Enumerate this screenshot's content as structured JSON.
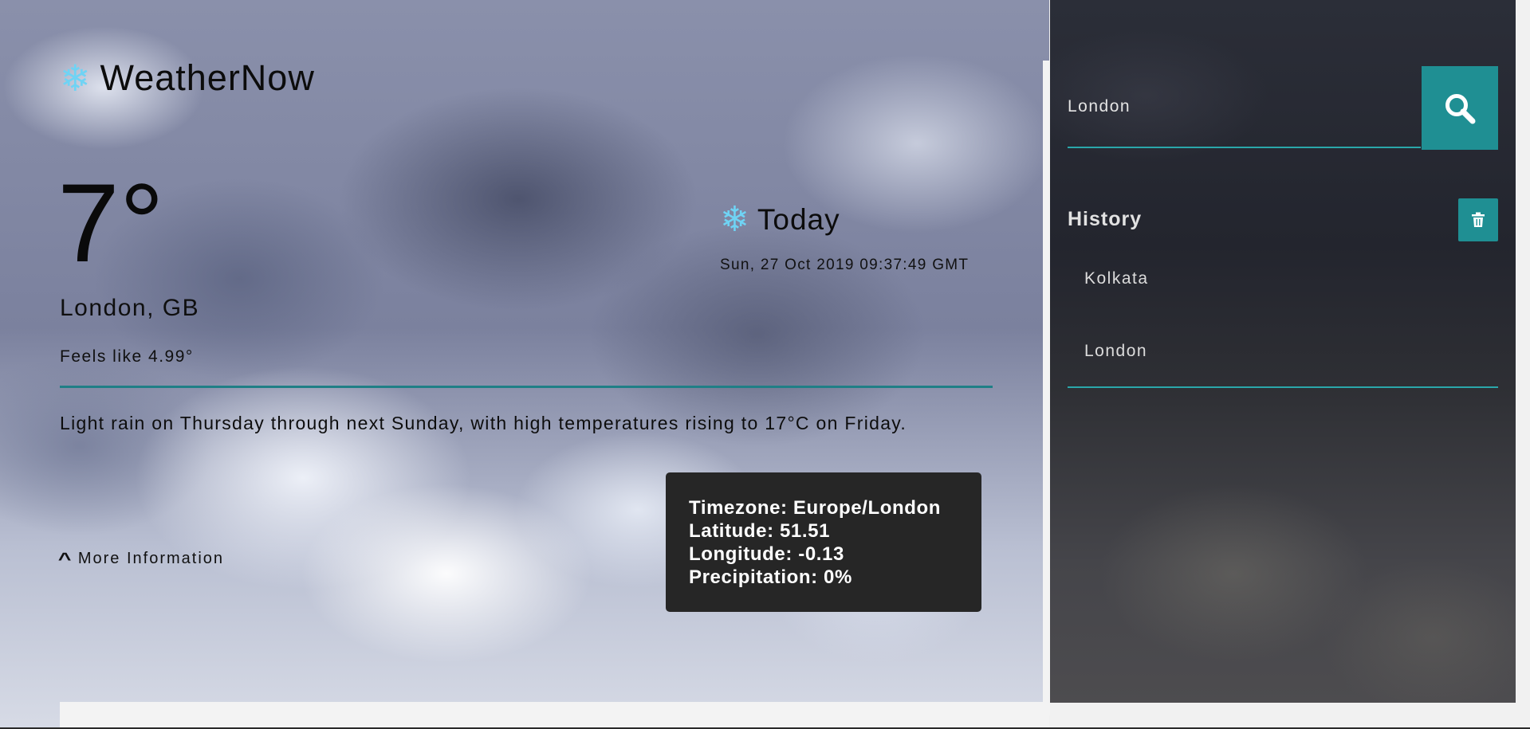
{
  "brand": {
    "name": "WeatherNow",
    "icon": "snowflake-icon"
  },
  "current": {
    "temperature": "7°",
    "location": "London, GB",
    "feels_like": "Feels like 4.99°"
  },
  "today": {
    "label": "Today",
    "icon": "snowflake-icon",
    "datetime": "Sun, 27 Oct 2019 09:37:49 GMT"
  },
  "forecast_summary": "Light rain on Thursday through next Sunday, with high temperatures rising to 17°C on Friday.",
  "more_info": {
    "label": "More Information",
    "icon": "chevron-up-icon"
  },
  "tooltip": {
    "timezone": "Timezone: Europe/London",
    "latitude": "Latitude: 51.51",
    "longitude": "Longitude: -0.13",
    "precipitation": "Precipitation: 0%"
  },
  "search": {
    "value": "London",
    "icon": "search-icon"
  },
  "history": {
    "title": "History",
    "clear_icon": "trash-icon",
    "items": [
      "Kolkata",
      "London"
    ]
  },
  "colors": {
    "accent": "#1f8f93",
    "accent_line": "#2aa7aa",
    "snowflake": "#6fd3f4",
    "tooltip_bg": "#262626"
  }
}
